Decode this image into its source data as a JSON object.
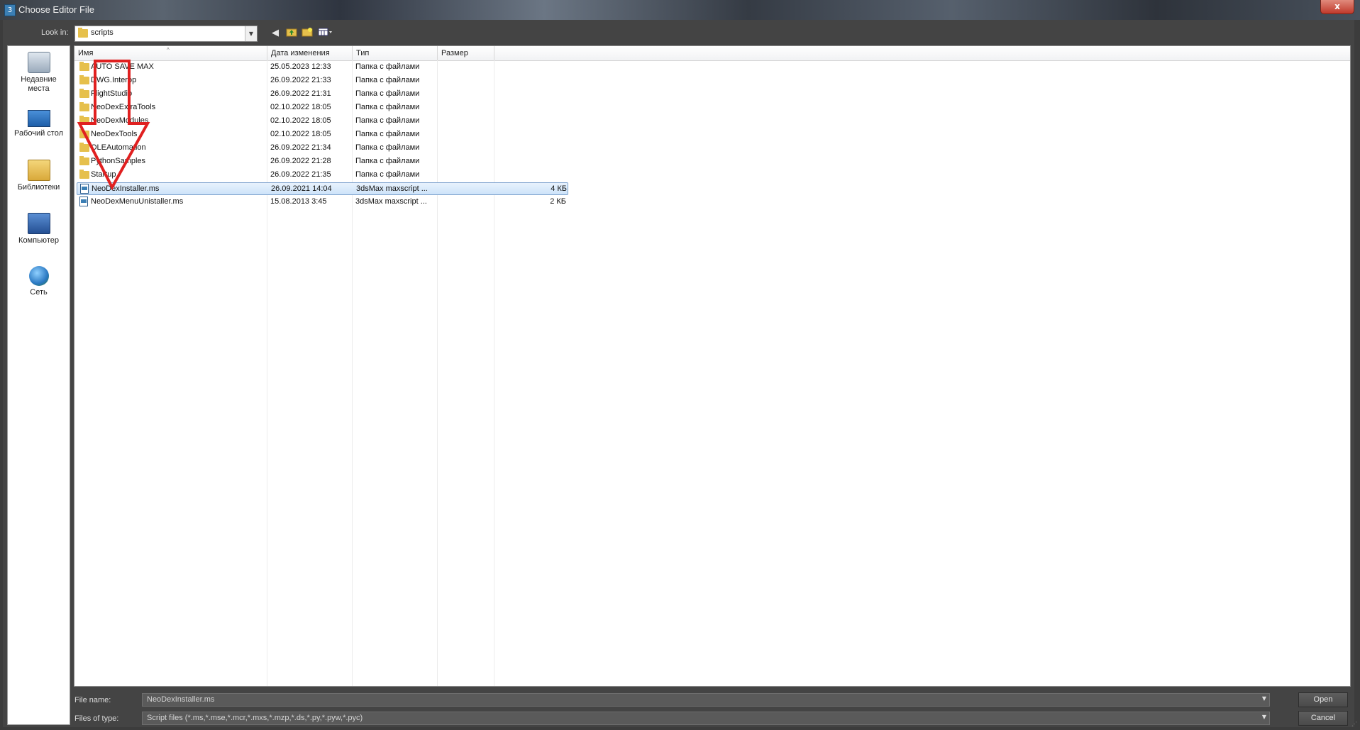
{
  "window": {
    "title": "Choose Editor File",
    "close_label": "x"
  },
  "toolbar": {
    "look_in_label": "Look in:",
    "look_in_value": "scripts",
    "back_icon": "back-arrow-icon",
    "up_icon": "up-folder-icon",
    "new_folder_icon": "new-folder-icon",
    "view_menu_icon": "view-menu-icon"
  },
  "places": [
    {
      "label": "Недавние места",
      "icon": "recent-places-icon"
    },
    {
      "label": "Рабочий стол",
      "icon": "desktop-icon"
    },
    {
      "label": "Библиотеки",
      "icon": "libraries-icon"
    },
    {
      "label": "Компьютер",
      "icon": "computer-icon"
    },
    {
      "label": "Сеть",
      "icon": "network-icon"
    }
  ],
  "columns": {
    "name": "Имя",
    "date": "Дата изменения",
    "type": "Тип",
    "size": "Размер"
  },
  "files": [
    {
      "name": "AUTO SAVE MAX",
      "date": "25.05.2023 12:33",
      "type": "Папка с файлами",
      "size": "",
      "kind": "folder"
    },
    {
      "name": "DWG.Interop",
      "date": "26.09.2022 21:33",
      "type": "Папка с файлами",
      "size": "",
      "kind": "folder"
    },
    {
      "name": "FlightStudio",
      "date": "26.09.2022 21:31",
      "type": "Папка с файлами",
      "size": "",
      "kind": "folder"
    },
    {
      "name": "NeoDexExtraTools",
      "date": "02.10.2022 18:05",
      "type": "Папка с файлами",
      "size": "",
      "kind": "folder"
    },
    {
      "name": "NeoDexModules",
      "date": "02.10.2022 18:05",
      "type": "Папка с файлами",
      "size": "",
      "kind": "folder"
    },
    {
      "name": "NeoDexTools",
      "date": "02.10.2022 18:05",
      "type": "Папка с файлами",
      "size": "",
      "kind": "folder"
    },
    {
      "name": "OLEAutomation",
      "date": "26.09.2022 21:34",
      "type": "Папка с файлами",
      "size": "",
      "kind": "folder"
    },
    {
      "name": "PythonSamples",
      "date": "26.09.2022 21:28",
      "type": "Папка с файлами",
      "size": "",
      "kind": "folder"
    },
    {
      "name": "Startup",
      "date": "26.09.2022 21:35",
      "type": "Папка с файлами",
      "size": "",
      "kind": "folder"
    },
    {
      "name": "NeoDexInstaller.ms",
      "date": "26.09.2021 14:04",
      "type": "3dsMax maxscript ...",
      "size": "4 КБ",
      "kind": "script",
      "selected": true
    },
    {
      "name": "NeoDexMenuUnistaller.ms",
      "date": "15.08.2013 3:45",
      "type": "3dsMax maxscript ...",
      "size": "2 КБ",
      "kind": "script"
    }
  ],
  "bottom": {
    "file_name_label": "File name:",
    "file_name_value": "NeoDexInstaller.ms",
    "files_of_type_label": "Files of type:",
    "files_of_type_value": "Script files (*.ms,*.mse,*.mcr,*.mxs,*.mzp,*.ds,*.py,*.pyw,*.pyc)",
    "open_label": "Open",
    "cancel_label": "Cancel"
  },
  "colors": {
    "annotation_arrow": "#e02020",
    "selection": "#cde3f9"
  }
}
